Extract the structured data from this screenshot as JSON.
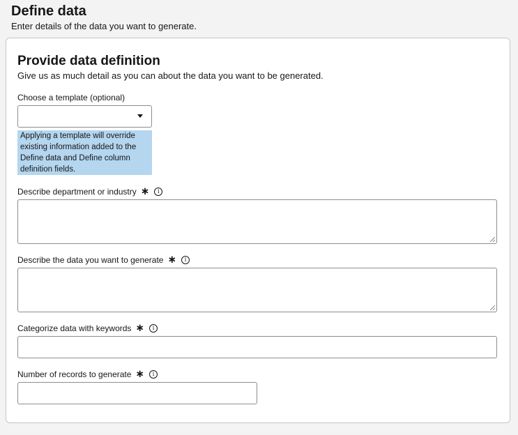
{
  "header": {
    "title": "Define data",
    "subtitle": "Enter details of the data you want to generate."
  },
  "card": {
    "title": "Provide data definition",
    "subtitle": "Give us as much detail as you can about the data you want to be generated."
  },
  "template": {
    "label": "Choose a template (optional)",
    "selected": "",
    "notice": "Applying a template will override existing information added to the Define data and Define column definition fields."
  },
  "fields": {
    "department": {
      "label": "Describe department or industry",
      "value": ""
    },
    "data_description": {
      "label": "Describe the data you want to generate",
      "value": ""
    },
    "keywords": {
      "label": "Categorize data with keywords",
      "value": ""
    },
    "records": {
      "label": "Number of records to generate",
      "value": ""
    }
  },
  "glyphs": {
    "required": "∗",
    "info": "i"
  },
  "colors": {
    "notice_bg": "#b4d6ef",
    "page_bg": "#f3f3f3",
    "border": "#8d8d8d"
  }
}
